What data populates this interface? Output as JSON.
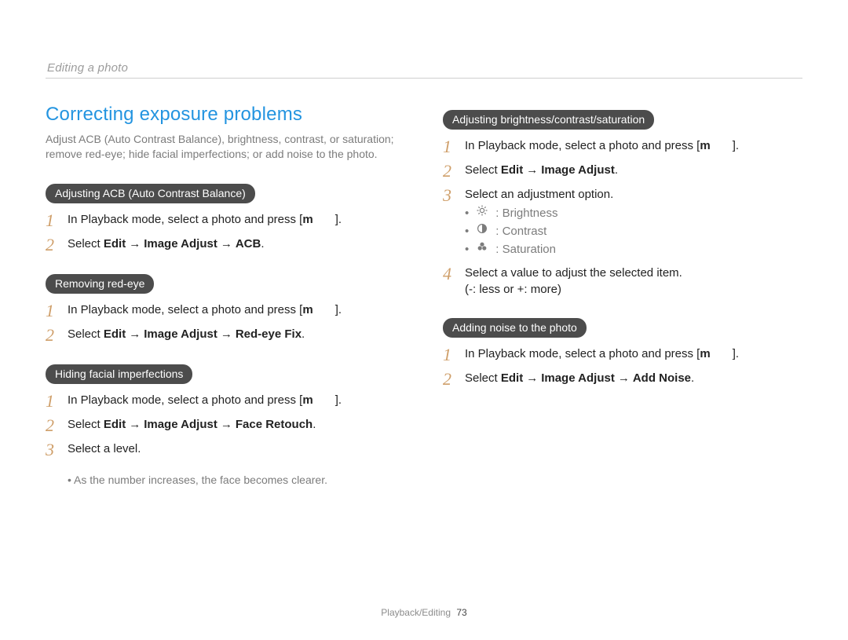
{
  "topic": "Editing a photo",
  "title": "Correcting exposure problems",
  "intro": "Adjust ACB (Auto Contrast Balance), brightness, contrast, or saturation; remove red-eye; hide facial imperfections; or add noise to the photo.",
  "sections": {
    "acb": {
      "heading": "Adjusting ACB (Auto Contrast Balance)",
      "step1_a": "In Playback mode, select a photo and press [",
      "step1_key": "m",
      "step1_b": "].",
      "step2_pre": "Select ",
      "step2_b1": "Edit",
      "step2_b2": "Image Adjust",
      "step2_b3": "ACB",
      "step2_post": "."
    },
    "redeye": {
      "heading": "Removing red-eye",
      "step1_a": "In Playback mode, select a photo and press [",
      "step1_key": "m",
      "step1_b": "].",
      "step2_pre": "Select ",
      "step2_b1": "Edit",
      "step2_b2": "Image Adjust",
      "step2_b3": "Red-eye Fix",
      "step2_post": "."
    },
    "face": {
      "heading": "Hiding facial imperfections",
      "step1_a": "In Playback mode, select a photo and press [",
      "step1_key": "m",
      "step1_b": "].",
      "step2_pre": "Select ",
      "step2_b1": "Edit",
      "step2_b2": "Image Adjust",
      "step2_b3": "Face Retouch",
      "step2_post": ".",
      "step3": "Select a level.",
      "note1": "As the number increases, the face becomes clearer."
    },
    "bcs": {
      "heading": "Adjusting brightness/contrast/saturation",
      "step1_a": "In Playback mode, select a photo and press [",
      "step1_key": "m",
      "step1_b": "].",
      "step2_pre": "Select ",
      "step2_b1": "Edit",
      "step2_b2": "Image Adjust",
      "step2_post": ".",
      "step3": "Select an adjustment option.",
      "opt_brightness": ": Brightness",
      "opt_contrast": ": Contrast",
      "opt_saturation": ": Saturation",
      "step4_a": "Select a value to adjust the selected item.",
      "step4_b": "(-: less or +: more)"
    },
    "noise": {
      "heading": "Adding noise to the photo",
      "step1_a": "In Playback mode, select a photo and press [",
      "step1_key": "m",
      "step1_b": "].",
      "step2_pre": "Select ",
      "step2_b1": "Edit",
      "step2_b2": "Image Adjust",
      "step2_b3": "Add Noise",
      "step2_post": "."
    }
  },
  "numbers": {
    "n1": "1",
    "n2": "2",
    "n3": "3",
    "n4": "4"
  },
  "arrow": "→",
  "footer": {
    "section": "Playback/Editing",
    "page": "73"
  }
}
